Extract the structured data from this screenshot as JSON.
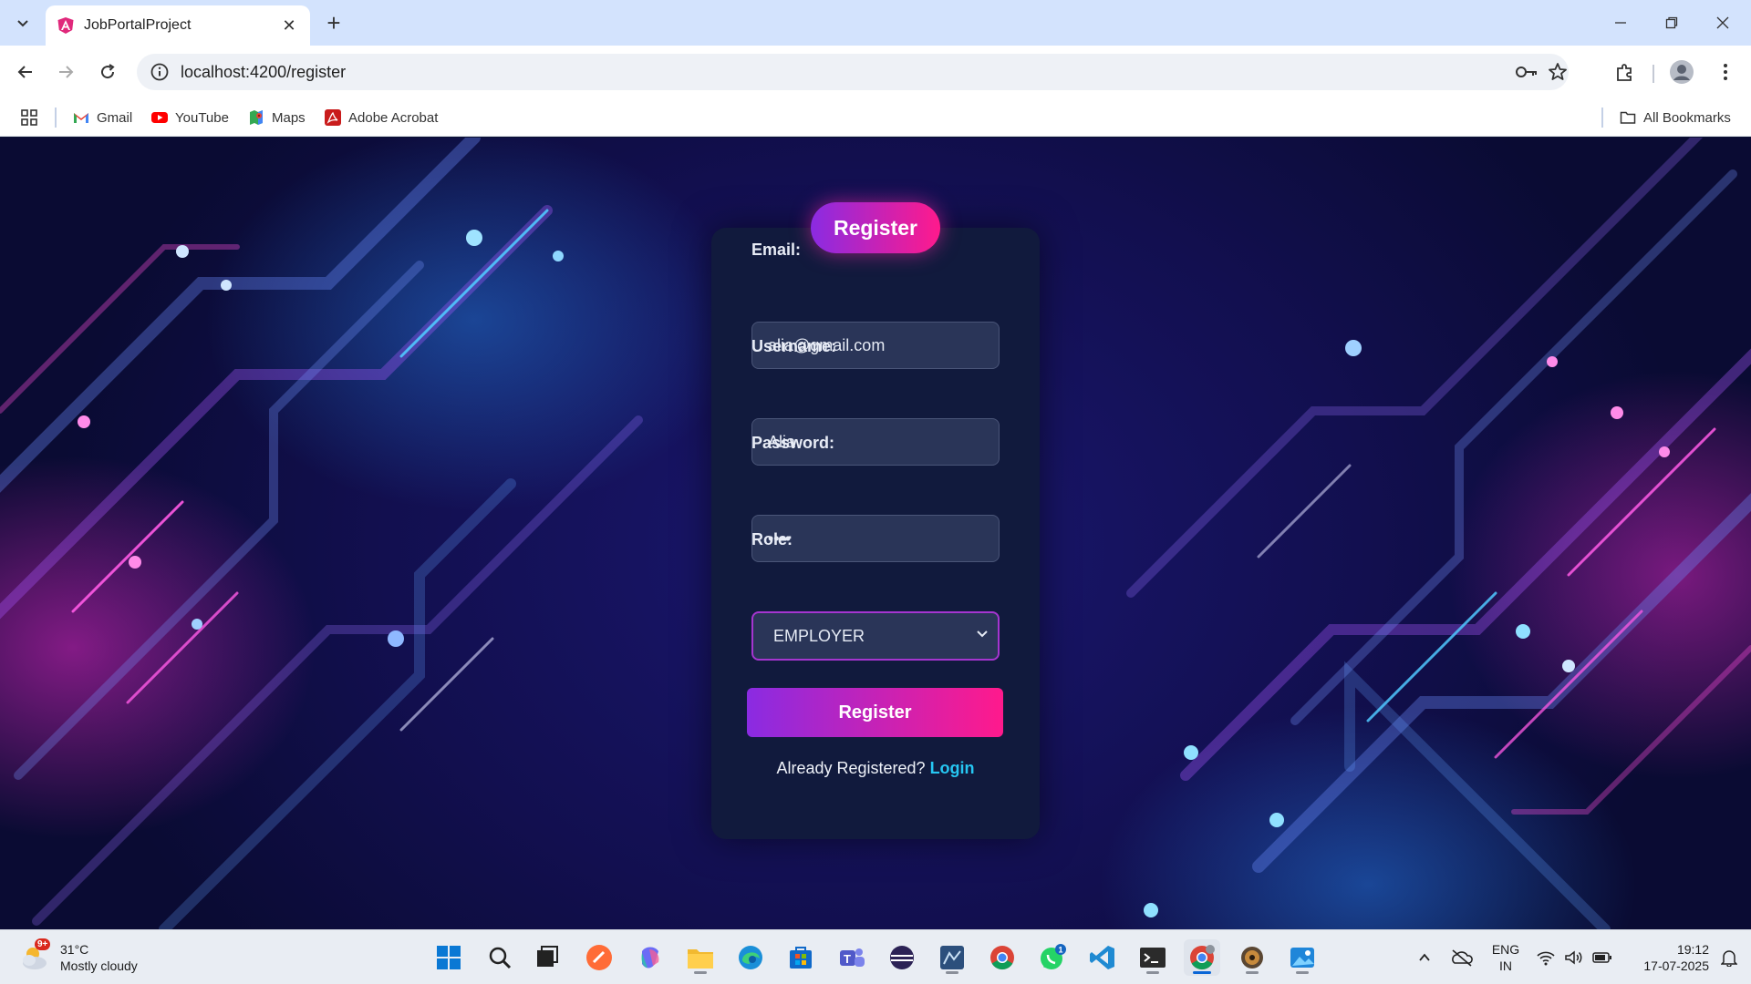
{
  "browser": {
    "tab_title": "JobPortalProject",
    "url": "localhost:4200/register",
    "bookmarks": [
      {
        "label": "Gmail",
        "icon": "gmail-icon"
      },
      {
        "label": "YouTube",
        "icon": "youtube-icon"
      },
      {
        "label": "Maps",
        "icon": "maps-icon"
      },
      {
        "label": "Adobe Acrobat",
        "icon": "adobe-acrobat-icon"
      }
    ],
    "all_bookmarks_label": "All Bookmarks"
  },
  "form": {
    "title": "Register",
    "email_label": "Email:",
    "email_value": "alia@gmail.com",
    "username_label": "Username:",
    "username_value": "Alia",
    "password_label": "Password:",
    "password_value": "••••",
    "role_label": "Role:",
    "role_value": "EMPLOYER",
    "submit_label": "Register",
    "already_text": "Already Registered?",
    "login_link": "Login"
  },
  "colors": {
    "accent_gradient_start": "#8a2be2",
    "accent_gradient_end": "#ff1a8c",
    "card_bg": "#111a3d",
    "link": "#26c6f2"
  },
  "taskbar": {
    "weather_badge": "9+",
    "temperature": "31°C",
    "weather_desc": "Mostly cloudy",
    "whatsapp_badge": "1",
    "lang_top": "ENG",
    "lang_bottom": "IN",
    "time": "19:12",
    "date": "17-07-2025"
  }
}
